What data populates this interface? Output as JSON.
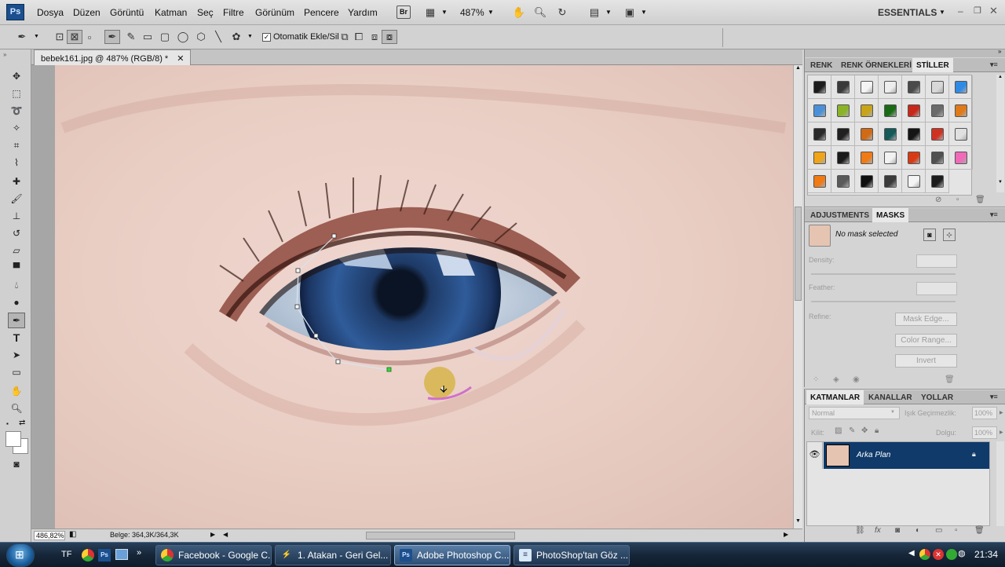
{
  "menu": {
    "app_logo": "Ps",
    "items": [
      "Dosya",
      "Düzen",
      "Görüntü",
      "Katman",
      "Seç",
      "Filtre",
      "Görünüm",
      "Pencere",
      "Yardım"
    ],
    "zoom": "487%",
    "bridge": "Br",
    "workspace": "ESSENTIALS"
  },
  "options": {
    "auto_add_delete": "Otomatik Ekle/Sil"
  },
  "document": {
    "tab_title": "bebek161.jpg @ 487% (RGB/8) *"
  },
  "status": {
    "zoom": "486,82%",
    "doc_size": "Belge: 364,3K/364,3K"
  },
  "styles_panel": {
    "tabs": [
      "RENK",
      "RENK ÖRNEKLERİ",
      "STİLLER"
    ],
    "active": "STİLLER",
    "swatch_colors": [
      [
        "#1c1c1c",
        "#3a3a3a",
        "#f4f4f4",
        "#ededed",
        "#4a4a4a",
        "#d8d8d8",
        "#2f8ae6"
      ],
      [
        "#4a90d8",
        "#8ab326",
        "#c8a418",
        "#1a6a14",
        "#c8281a",
        "#6a6a6a",
        "#e07a18"
      ],
      [
        "#2a2a2a",
        "#202020",
        "#d06a14",
        "#135a58",
        "#151515",
        "#d03222",
        "#e0e0e0"
      ],
      [
        "#f0a418",
        "#1a1a1a",
        "#f07a14",
        "#f2f2f2",
        "#d83a14",
        "#505050",
        "#f06ab8"
      ],
      [
        "#f07a14",
        "#5a5a5a",
        "#101010",
        "#3a3a3a",
        "#f4f4f4",
        "#1c1c1c"
      ]
    ]
  },
  "masks_panel": {
    "tabs": [
      "ADJUSTMENTS",
      "MASKS"
    ],
    "active": "MASKS",
    "no_mask": "No mask selected",
    "density_label": "Density:",
    "feather_label": "Feather:",
    "refine_label": "Refine:",
    "buttons": [
      "Mask Edge...",
      "Color Range...",
      "Invert"
    ]
  },
  "layers_panel": {
    "tabs": [
      "KATMANLAR",
      "KANALLAR",
      "YOLLAR"
    ],
    "active": "KATMANLAR",
    "blend_mode": "Normal",
    "opacity_label": "Işık Geçirmezlik:",
    "opacity": "100%",
    "lock_label": "Kilit:",
    "fill_label": "Dolgu:",
    "fill": "100%",
    "layers": [
      {
        "name": "Arka Plan"
      }
    ]
  },
  "taskbar": {
    "lang": "TF",
    "tasks": [
      {
        "label": "Facebook - Google C...",
        "icon": "chrome-icon"
      },
      {
        "label": "1. Atakan - Geri Gel...",
        "icon": "winamp-icon"
      },
      {
        "label": "Adobe Photoshop C...",
        "icon": "photoshop-icon"
      },
      {
        "label": "PhotoShop'tan Göz ...",
        "icon": "notepad-icon"
      }
    ],
    "clock": "21:34"
  },
  "colors": {
    "panel_bg": "#d6d6d6",
    "layer_selected": "#0f3a6a",
    "iris": "#2c5694"
  }
}
